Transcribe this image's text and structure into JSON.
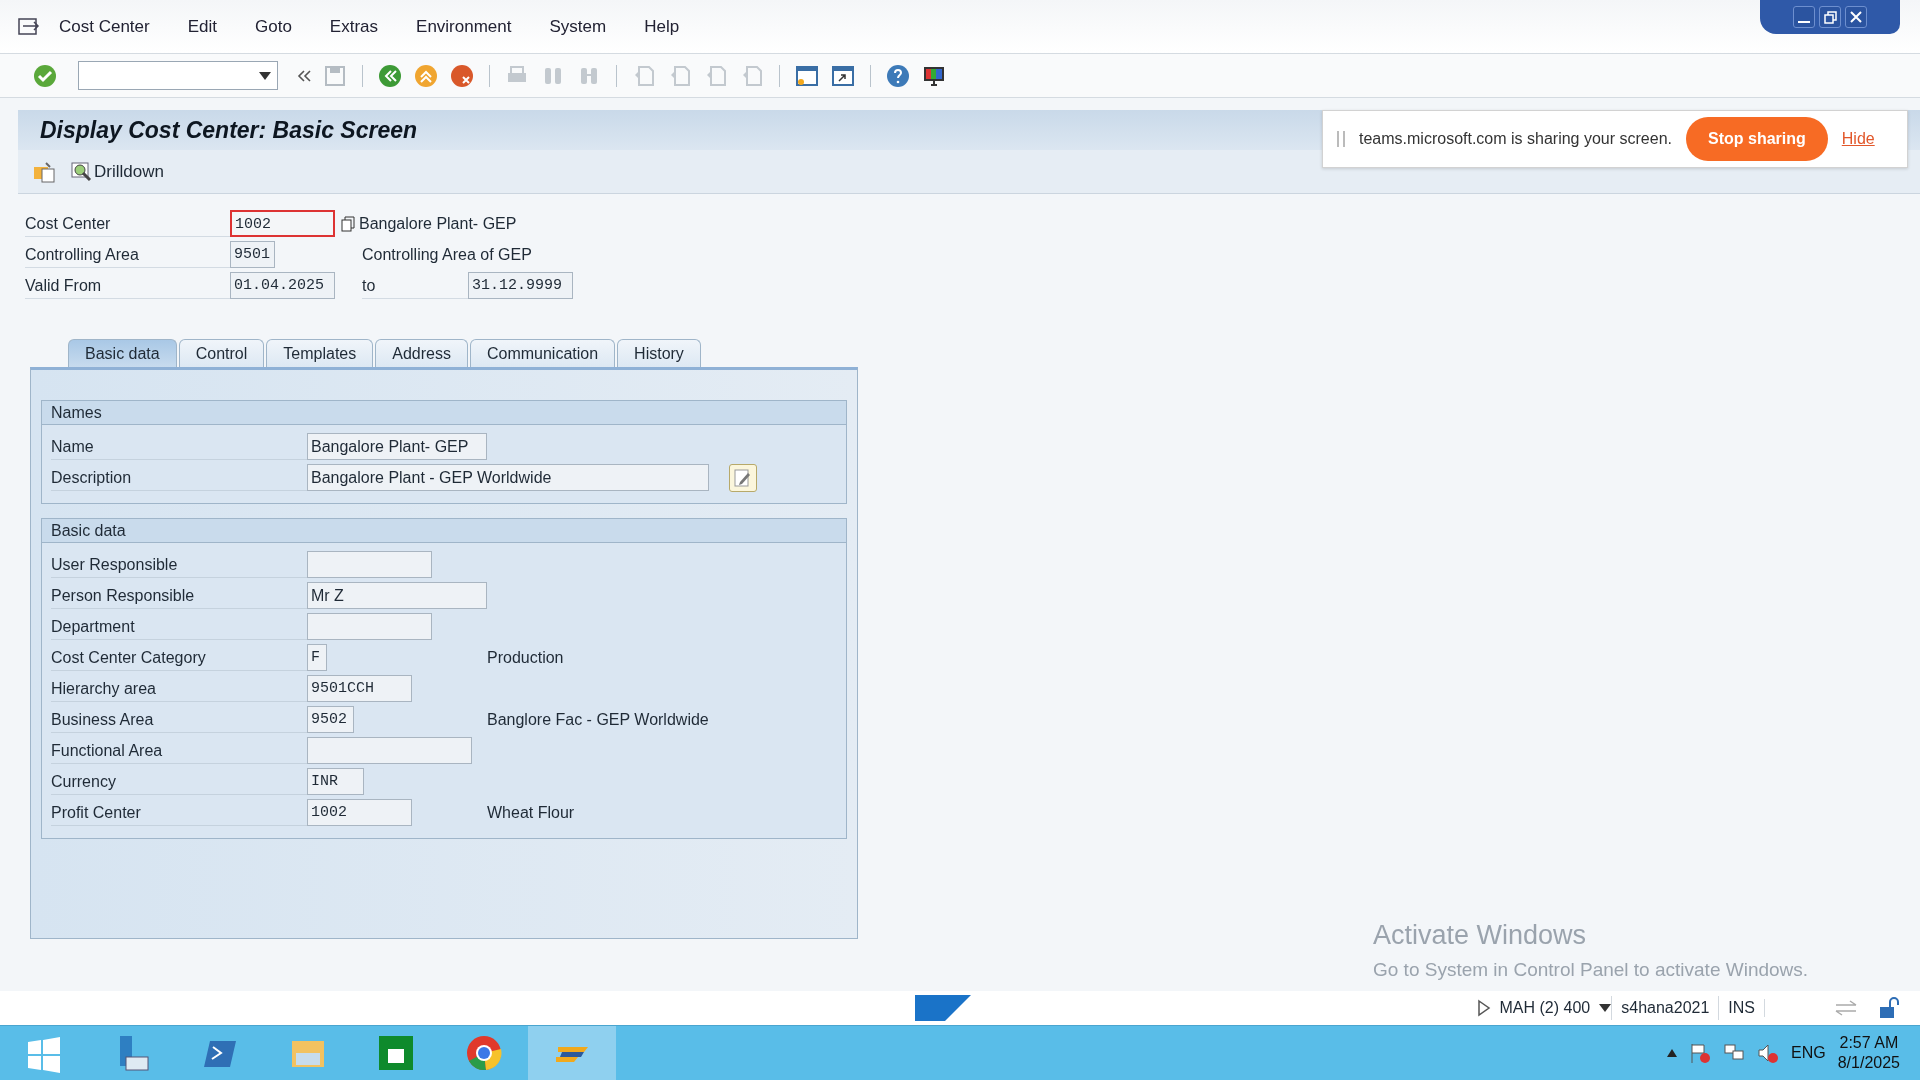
{
  "menu": [
    "Cost Center",
    "Edit",
    "Goto",
    "Extras",
    "Environment",
    "System",
    "Help"
  ],
  "title": "Display Cost Center: Basic Screen",
  "app_toolbar": [
    {
      "kind": "icon"
    },
    {
      "kind": "button",
      "label": "Drilldown"
    }
  ],
  "teams_banner": {
    "message": "teams.microsoft.com is sharing your screen.",
    "button": "Stop sharing",
    "link": "Hide"
  },
  "header": [
    {
      "label": "Cost Center",
      "value": "1002",
      "focused": true,
      "description": "Bangalore Plant- GEP"
    },
    {
      "label": "Controlling Area",
      "value": "9501",
      "focused": false,
      "description": "Controlling Area of GEP"
    },
    {
      "label": "Valid From",
      "value": "01.04.2025",
      "focused": false,
      "to_label": "to",
      "to_value": "31.12.9999"
    }
  ],
  "tabs": [
    {
      "label": "Basic data",
      "selected": true
    },
    {
      "label": "Control",
      "selected": false
    },
    {
      "label": "Templates",
      "selected": false
    },
    {
      "label": "Address",
      "selected": false
    },
    {
      "label": "Communication",
      "selected": false
    },
    {
      "label": "History",
      "selected": false
    }
  ],
  "groups": [
    {
      "title": "Names",
      "rows": [
        {
          "label": "Name",
          "value": "Bangalore Plant- GEP"
        },
        {
          "label": "Description",
          "value": "Bangalore Plant - GEP Worldwide",
          "edit_button": true
        }
      ]
    },
    {
      "title": "Basic data",
      "rows": [
        {
          "label": "User Responsible",
          "value": ""
        },
        {
          "label": "Person Responsible",
          "value": "Mr Z"
        },
        {
          "label": "Department",
          "value": ""
        },
        {
          "label": "Cost Center Category",
          "value": "F",
          "mono": true,
          "description": "Production"
        },
        {
          "label": "Hierarchy area",
          "value": "9501CCH",
          "mono": true
        },
        {
          "label": "Business Area",
          "value": "9502",
          "mono": true,
          "description": "Banglore Fac - GEP Worldwide"
        },
        {
          "label": "Functional Area",
          "value": ""
        },
        {
          "label": "Currency",
          "value": "INR",
          "mono": true
        },
        {
          "label": "Profit Center",
          "value": "1002",
          "mono": true,
          "description": "Wheat Flour"
        }
      ]
    }
  ],
  "activation_notice": {
    "title": "Activate Windows",
    "message": "Go to System in Control Panel to activate Windows."
  },
  "status_bar": {
    "system": "MAH (2) 400",
    "server": "s4hana2021",
    "mode": "INS"
  },
  "taskbar": {
    "language": "ENG",
    "time": "2:57 AM",
    "date": "8/1/2025"
  }
}
